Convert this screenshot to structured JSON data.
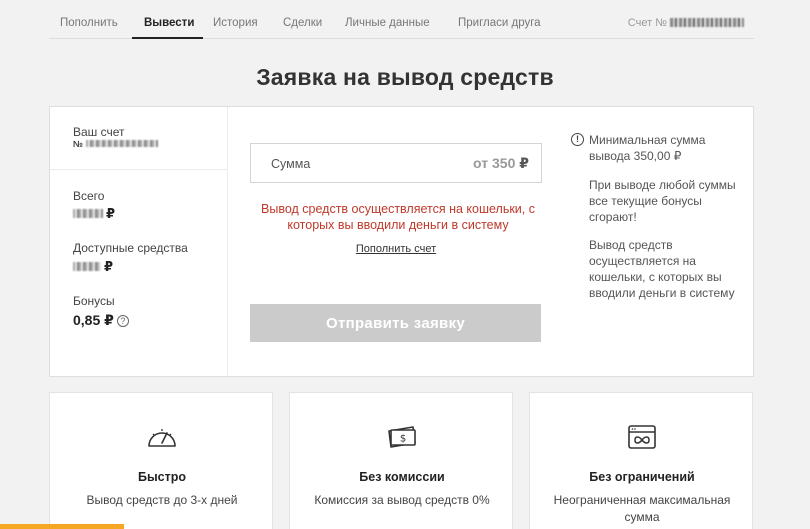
{
  "nav": {
    "tabs": [
      {
        "label": "Пополнить"
      },
      {
        "label": "Вывести"
      },
      {
        "label": "История"
      },
      {
        "label": "Сделки"
      },
      {
        "label": "Личные данные"
      },
      {
        "label": "Пригласи друга"
      }
    ],
    "active_tab": "Вывести",
    "account_label": "Счет №"
  },
  "page_title": "Заявка на вывод средств",
  "account_panel": {
    "your_account_label": "Ваш счет",
    "account_number_prefix": "№",
    "total_label": "Всего",
    "available_label": "Доступные средства",
    "bonus_label": "Бонусы",
    "bonus_value": "0,85",
    "currency": "₽"
  },
  "withdraw_form": {
    "amount_placeholder": "Сумма",
    "amount_min": "от 350",
    "warning": "Вывод средств осуществляется на кошельки, с которых вы вводили деньги в систему",
    "topup_link": "Пополнить счет",
    "submit_label": "Отправить заявку"
  },
  "info": {
    "min_amount": "Минимальная сумма вывода 350,00 ₽",
    "bonus_note": "При выводе любой суммы все текущие бонусы сгорают!",
    "wallet_note": "Вывод средств осуществляется на кошельки, с которых вы вводили деньги в систему"
  },
  "features": [
    {
      "icon": "speedometer-icon",
      "title": "Быстро",
      "desc": "Вывод средств до 3-х дней"
    },
    {
      "icon": "money-icon",
      "title": "Без комиссии",
      "desc": "Комиссия за вывод средств 0%"
    },
    {
      "icon": "infinity-card-icon",
      "title": "Без ограничений",
      "desc": "Неограниченная максимальная сумма"
    }
  ],
  "colors": {
    "warning": "#c0392b",
    "button_disabled": "#cbcbcb",
    "accent_orange": "#f5a623"
  }
}
